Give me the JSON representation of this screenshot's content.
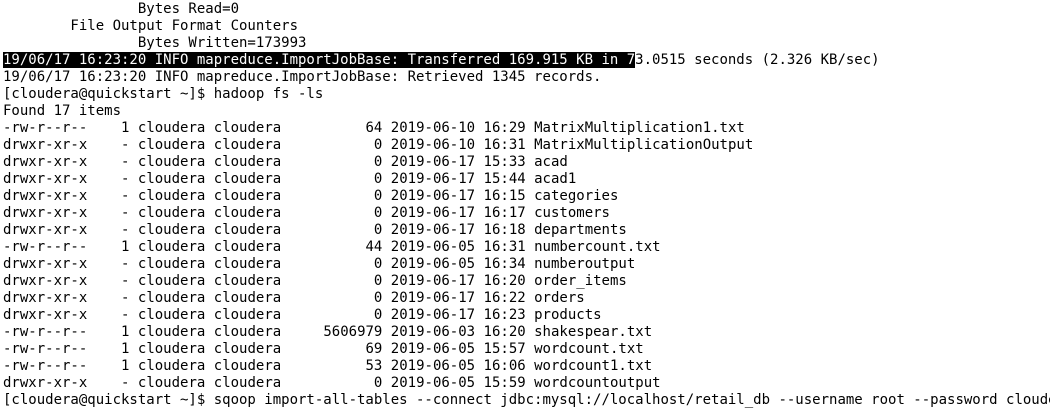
{
  "terminal": {
    "counter_lines": [
      "                Bytes Read=0",
      "        File Output Format Counters",
      "                Bytes Written=173993"
    ],
    "transfer_line": {
      "selected_text": "19/06/17 16:23:20 INFO mapreduce.ImportJobBase: Transferred 169.915 KB in 7",
      "rest_text": "3.0515 seconds (2.326 KB/sec)"
    },
    "retrieved_line": "19/06/17 16:23:20 INFO mapreduce.ImportJobBase: Retrieved 1345 records.",
    "prompt": "[cloudera@quickstart ~]$ ",
    "ls_command": "hadoop fs -ls",
    "found_line": "Found 17 items",
    "listing": [
      {
        "perms": "-rw-r--r--",
        "repl": "1",
        "owner": "cloudera",
        "group": "cloudera",
        "size": "64",
        "date": "2019-06-10",
        "time": "16:29",
        "name": "MatrixMultiplication1.txt"
      },
      {
        "perms": "drwxr-xr-x",
        "repl": "-",
        "owner": "cloudera",
        "group": "cloudera",
        "size": "0",
        "date": "2019-06-10",
        "time": "16:31",
        "name": "MatrixMultiplicationOutput"
      },
      {
        "perms": "drwxr-xr-x",
        "repl": "-",
        "owner": "cloudera",
        "group": "cloudera",
        "size": "0",
        "date": "2019-06-17",
        "time": "15:33",
        "name": "acad"
      },
      {
        "perms": "drwxr-xr-x",
        "repl": "-",
        "owner": "cloudera",
        "group": "cloudera",
        "size": "0",
        "date": "2019-06-17",
        "time": "15:44",
        "name": "acad1"
      },
      {
        "perms": "drwxr-xr-x",
        "repl": "-",
        "owner": "cloudera",
        "group": "cloudera",
        "size": "0",
        "date": "2019-06-17",
        "time": "16:15",
        "name": "categories"
      },
      {
        "perms": "drwxr-xr-x",
        "repl": "-",
        "owner": "cloudera",
        "group": "cloudera",
        "size": "0",
        "date": "2019-06-17",
        "time": "16:17",
        "name": "customers"
      },
      {
        "perms": "drwxr-xr-x",
        "repl": "-",
        "owner": "cloudera",
        "group": "cloudera",
        "size": "0",
        "date": "2019-06-17",
        "time": "16:18",
        "name": "departments"
      },
      {
        "perms": "-rw-r--r--",
        "repl": "1",
        "owner": "cloudera",
        "group": "cloudera",
        "size": "44",
        "date": "2019-06-05",
        "time": "16:31",
        "name": "numbercount.txt"
      },
      {
        "perms": "drwxr-xr-x",
        "repl": "-",
        "owner": "cloudera",
        "group": "cloudera",
        "size": "0",
        "date": "2019-06-05",
        "time": "16:34",
        "name": "numberoutput"
      },
      {
        "perms": "drwxr-xr-x",
        "repl": "-",
        "owner": "cloudera",
        "group": "cloudera",
        "size": "0",
        "date": "2019-06-17",
        "time": "16:20",
        "name": "order_items"
      },
      {
        "perms": "drwxr-xr-x",
        "repl": "-",
        "owner": "cloudera",
        "group": "cloudera",
        "size": "0",
        "date": "2019-06-17",
        "time": "16:22",
        "name": "orders"
      },
      {
        "perms": "drwxr-xr-x",
        "repl": "-",
        "owner": "cloudera",
        "group": "cloudera",
        "size": "0",
        "date": "2019-06-17",
        "time": "16:23",
        "name": "products"
      },
      {
        "perms": "-rw-r--r--",
        "repl": "1",
        "owner": "cloudera",
        "group": "cloudera",
        "size": "5606979",
        "date": "2019-06-03",
        "time": "16:20",
        "name": "shakespear.txt"
      },
      {
        "perms": "-rw-r--r--",
        "repl": "1",
        "owner": "cloudera",
        "group": "cloudera",
        "size": "69",
        "date": "2019-06-05",
        "time": "15:57",
        "name": "wordcount.txt"
      },
      {
        "perms": "-rw-r--r--",
        "repl": "1",
        "owner": "cloudera",
        "group": "cloudera",
        "size": "53",
        "date": "2019-06-05",
        "time": "16:06",
        "name": "wordcount1.txt"
      },
      {
        "perms": "drwxr-xr-x",
        "repl": "-",
        "owner": "cloudera",
        "group": "cloudera",
        "size": "0",
        "date": "2019-06-05",
        "time": "15:59",
        "name": "wordcountoutput"
      }
    ],
    "current_command": "sqoop import-all-tables --connect jdbc:mysql://localhost/retail_db --username root --password cloudera "
  }
}
